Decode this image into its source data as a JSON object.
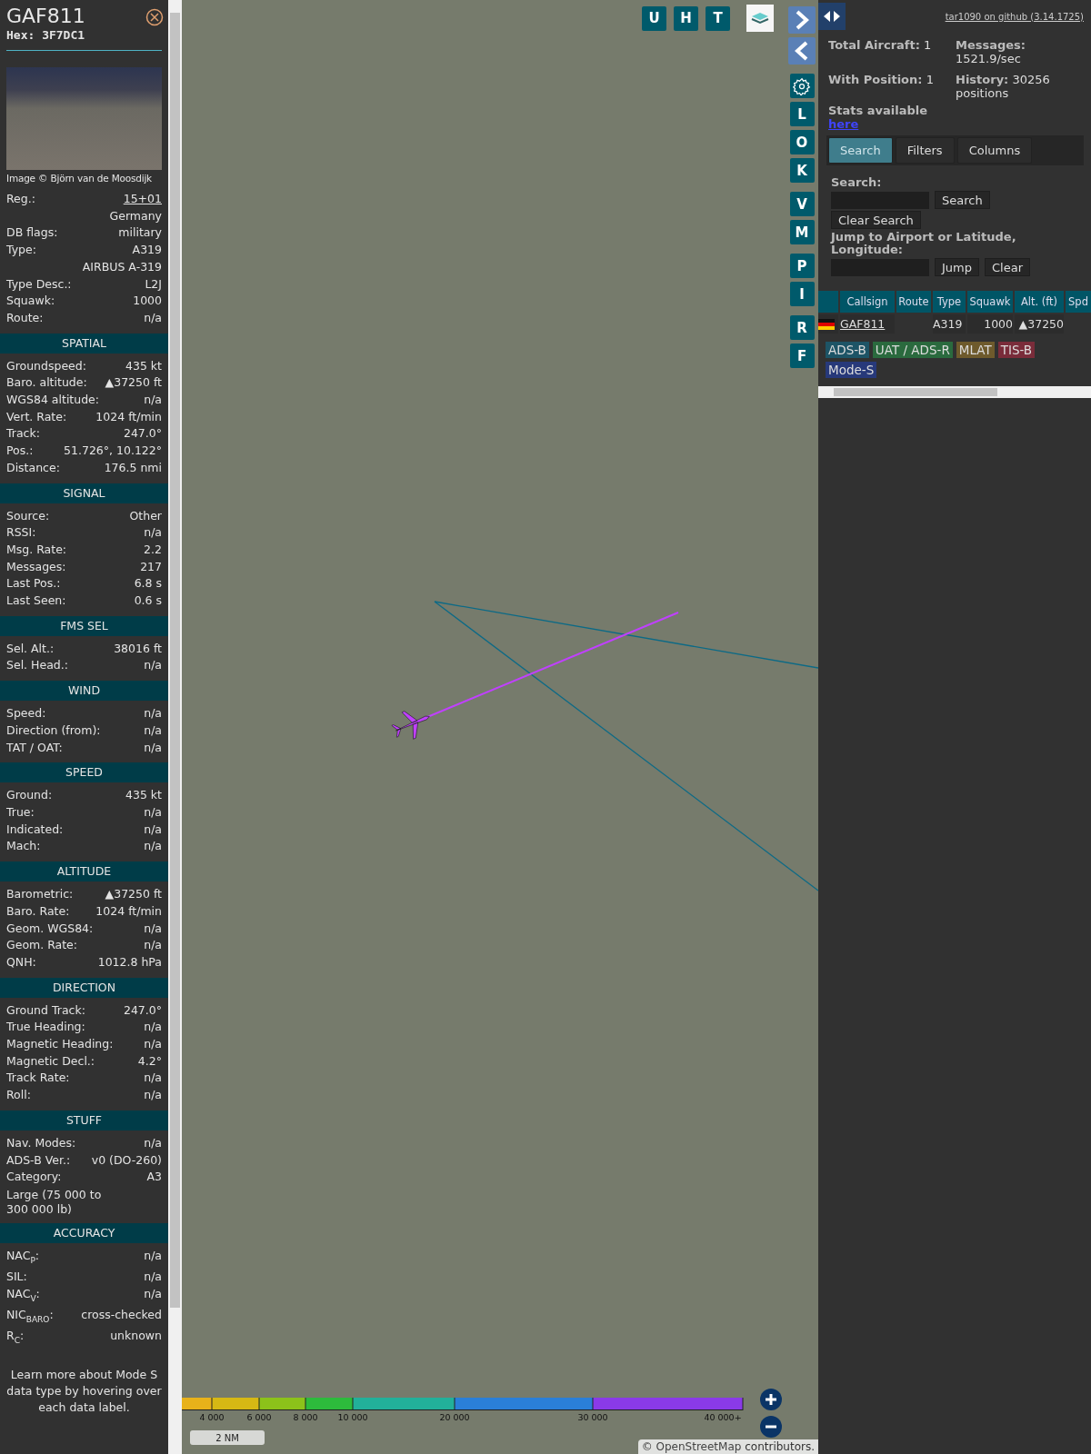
{
  "detail": {
    "callsign": "GAF811",
    "hex": "Hex: 3F7DC1",
    "photo_credit": "Image © Björn van de Moosdijk",
    "rows": [
      {
        "kind": "link",
        "label": "Reg.:",
        "value": "15+01"
      },
      {
        "kind": "value",
        "value": "Germany"
      },
      {
        "kind": "pair",
        "label": "DB flags:",
        "value": "military"
      },
      {
        "kind": "pair",
        "label": "Type:",
        "value": "A319"
      },
      {
        "kind": "value",
        "value": "AIRBUS A-319"
      },
      {
        "kind": "pair",
        "label": "Type Desc.:",
        "value": "L2J"
      },
      {
        "kind": "pair",
        "label": "Squawk:",
        "value": "1000"
      },
      {
        "kind": "pair",
        "label": "Route:",
        "value": "n/a"
      }
    ],
    "sections": [
      {
        "title": "SPATIAL",
        "rows": [
          {
            "kind": "pair",
            "label": "Groundspeed:",
            "value": "435 kt"
          },
          {
            "kind": "pair",
            "label": "Baro. altitude:",
            "value": "▲37250 ft"
          },
          {
            "kind": "pair",
            "label": "WGS84 altitude:",
            "value": "n/a"
          },
          {
            "kind": "pair",
            "label": "Vert. Rate:",
            "value": "1024 ft/min"
          },
          {
            "kind": "pair",
            "label": "Track:",
            "value": "247.0°"
          },
          {
            "kind": "pair",
            "label": "Pos.:",
            "value": "51.726°, 10.122°"
          },
          {
            "kind": "pair",
            "label": "Distance:",
            "value": "176.5 nmi"
          }
        ]
      },
      {
        "title": "SIGNAL",
        "rows": [
          {
            "kind": "pair",
            "label": "Source:",
            "value": "Other"
          },
          {
            "kind": "pair",
            "label": "RSSI:",
            "value": "n/a"
          },
          {
            "kind": "pair",
            "label": "Msg. Rate:",
            "value": "2.2"
          },
          {
            "kind": "pair",
            "label": "Messages:",
            "value": "217"
          },
          {
            "kind": "pair",
            "label": "Last Pos.:",
            "value": "6.8 s"
          },
          {
            "kind": "pair",
            "label": "Last Seen:",
            "value": "0.6 s"
          }
        ]
      },
      {
        "title": "FMS SEL",
        "rows": [
          {
            "kind": "pair",
            "label": "Sel. Alt.:",
            "value": "38016 ft"
          },
          {
            "kind": "pair",
            "label": "Sel. Head.:",
            "value": "n/a"
          }
        ]
      },
      {
        "title": "WIND",
        "rows": [
          {
            "kind": "pair",
            "label": "Speed:",
            "value": "n/a"
          },
          {
            "kind": "pair",
            "label": "Direction (from):",
            "value": "n/a"
          },
          {
            "kind": "pair",
            "label": "TAT / OAT:",
            "value": "n/a"
          }
        ]
      },
      {
        "title": "SPEED",
        "rows": [
          {
            "kind": "pair",
            "label": "Ground:",
            "value": "435 kt"
          },
          {
            "kind": "pair",
            "label": "True:",
            "value": "n/a"
          },
          {
            "kind": "pair",
            "label": "Indicated:",
            "value": "n/a"
          },
          {
            "kind": "pair",
            "label": "Mach:",
            "value": "n/a"
          }
        ]
      },
      {
        "title": "ALTITUDE",
        "rows": [
          {
            "kind": "pair",
            "label": "Barometric:",
            "value": "▲37250 ft"
          },
          {
            "kind": "pair",
            "label": "Baro. Rate:",
            "value": "1024 ft/min"
          },
          {
            "kind": "pair",
            "label": "Geom. WGS84:",
            "value": "n/a"
          },
          {
            "kind": "pair",
            "label": "Geom. Rate:",
            "value": "n/a"
          },
          {
            "kind": "pair",
            "label": "QNH:",
            "value": "1012.8 hPa"
          }
        ]
      },
      {
        "title": "DIRECTION",
        "rows": [
          {
            "kind": "pair",
            "label": "Ground Track:",
            "value": "247.0°"
          },
          {
            "kind": "pair",
            "label": "True Heading:",
            "value": "n/a"
          },
          {
            "kind": "pair",
            "label": "Magnetic Heading:",
            "value": "n/a"
          },
          {
            "kind": "pair",
            "label": "Magnetic Decl.:",
            "value": "4.2°"
          },
          {
            "kind": "pair",
            "label": "Track Rate:",
            "value": "n/a"
          },
          {
            "kind": "pair",
            "label": "Roll:",
            "value": "n/a"
          }
        ]
      },
      {
        "title": "STUFF",
        "rows": [
          {
            "kind": "pair",
            "label": "Nav. Modes:",
            "value": "n/a"
          },
          {
            "kind": "pair",
            "label": "ADS-B Ver.:",
            "value": "v0 (DO-260)"
          },
          {
            "kind": "pair",
            "label": "Category:",
            "value": "A3"
          },
          {
            "kind": "note",
            "value": "Large (75 000 to 300 000 lb)"
          }
        ]
      },
      {
        "title": "ACCURACY",
        "rows": [
          {
            "kind": "pair",
            "label": "NAC$_{P}$:",
            "value": "n/a"
          },
          {
            "kind": "pair",
            "label": "SIL:",
            "value": "n/a"
          },
          {
            "kind": "pair",
            "label": "NAC$_{V}$:",
            "value": "n/a"
          },
          {
            "kind": "pair",
            "label": "NIC$_{BARO}$:",
            "value": "cross-checked"
          },
          {
            "kind": "pair",
            "label": "R$_{C}$:",
            "value": "unknown"
          }
        ]
      }
    ],
    "footer": "Learn more about Mode S data type by hovering over each data label."
  },
  "map": {
    "top_buttons": [
      "U",
      "H",
      "T"
    ],
    "side_groups": [
      [
        "L",
        "O",
        "K"
      ],
      [
        "V",
        "M"
      ],
      [
        "P",
        "I"
      ],
      [
        "R",
        "F"
      ]
    ],
    "altitude_legend": [
      "4 000",
      "6 000",
      "8 000",
      "10 000",
      "20 000",
      "30 000",
      "40 000+"
    ],
    "scale": "2 NM",
    "attribution": {
      "prefix": "©",
      "link": "OpenStreetMap",
      "suffix": "contributors."
    }
  },
  "panel": {
    "github": "tar1090 on github (3.14.1725)",
    "stats": [
      "**Total Aircraft:** 1",
      "**Messages:** 1521.9/sec",
      "**With Position:** 1",
      "**History:** 30256 positions"
    ],
    "stats_text": "Stats available",
    "stats_link": "here",
    "tabs": [
      {
        "label": "Search",
        "selected": true
      },
      {
        "label": "Filters",
        "selected": false
      },
      {
        "label": "Columns",
        "selected": false
      }
    ],
    "search_label": "Search:",
    "search_button": "Search",
    "clear_search_button": "Clear Search",
    "jump_label": "Jump to Airport or Latitude, Longitude:",
    "jump_button": "Jump",
    "clear_button": "Clear",
    "table": {
      "columns": [
        "Callsign",
        "Route",
        "Type",
        "Squawk",
        "Alt. (ft)",
        "Spd"
      ],
      "rows": [
        {
          "callsign": "GAF811",
          "type": "A319",
          "squawk": "1000",
          "altitude": "▲37250"
        }
      ]
    },
    "sources": [
      {
        "label": "ADS-B",
        "color": "#1d5466"
      },
      {
        "label": "UAT / ADS-R",
        "color": "#2a6a3e"
      },
      {
        "label": "MLAT",
        "color": "#6e5a2c"
      },
      {
        "label": "TIS-B",
        "color": "#7a2c3a"
      },
      {
        "label": "Mode-S",
        "color": "#27397a"
      }
    ]
  }
}
